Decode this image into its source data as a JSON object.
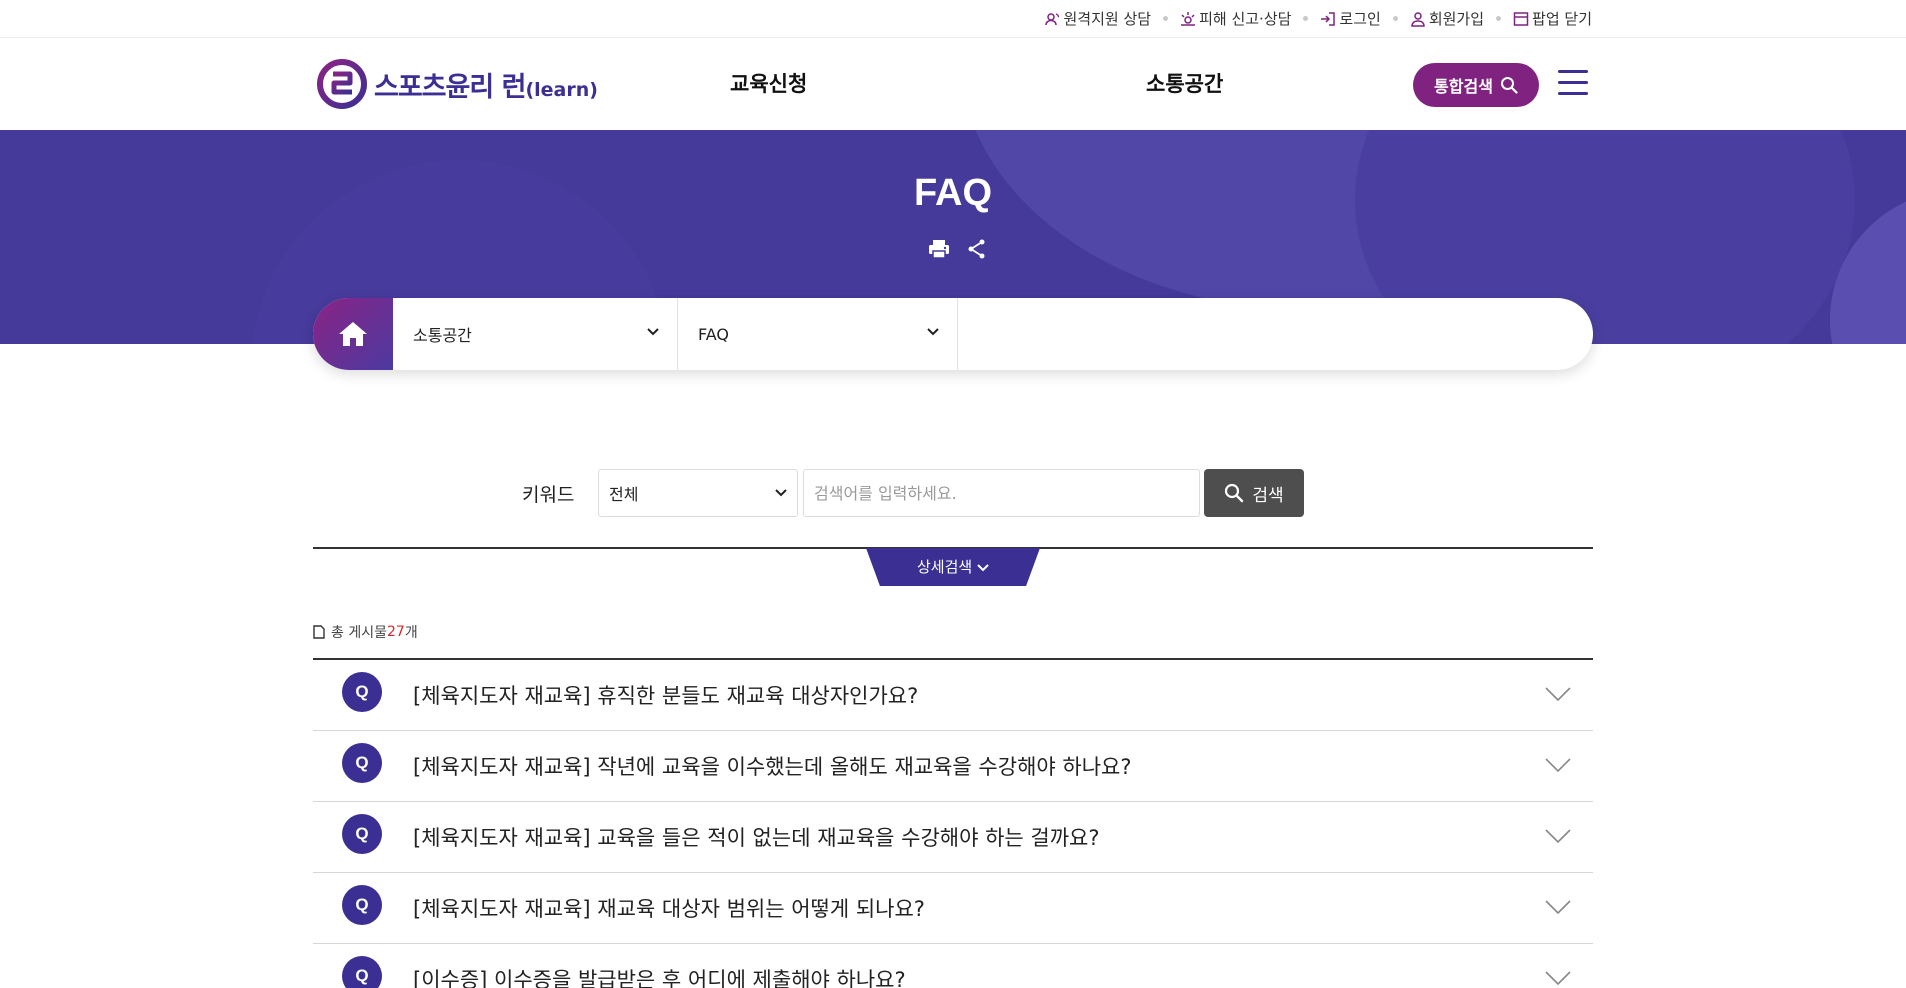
{
  "utility": {
    "items": [
      {
        "label": "원격지원 상담",
        "icon": "remote-support-icon"
      },
      {
        "label": "피해 신고·상담",
        "icon": "report-icon"
      },
      {
        "label": "로그인",
        "icon": "login-icon"
      },
      {
        "label": "회원가입",
        "icon": "user-icon"
      },
      {
        "label": "팝업 닫기",
        "icon": "popup-icon"
      }
    ]
  },
  "header": {
    "logo_main": "스포츠윤리 런",
    "logo_sub": "(learn)",
    "nav": [
      "교육신청",
      "소통공간"
    ],
    "search_all_label": "통합검색"
  },
  "banner": {
    "title": "FAQ"
  },
  "location": {
    "depth1": "소통공간",
    "depth2": "FAQ"
  },
  "search": {
    "label": "키워드",
    "select_value": "전체",
    "placeholder": "검색어를 입력하세요.",
    "button_label": "검색",
    "detail_label": "상세검색"
  },
  "list": {
    "total_prefix": "총 게시물 ",
    "total_count": "27",
    "total_suffix": "개",
    "badge": "Q",
    "items": [
      "[체육지도자 재교육] 휴직한 분들도 재교육 대상자인가요?",
      "[체육지도자 재교육] 작년에 교육을 이수했는데 올해도 재교육을 수강해야 하나요?",
      "[체육지도자 재교육] 교육을 들은 적이 없는데 재교육을 수강해야 하는 걸까요?",
      "[체육지도자 재교육] 재교육 대상자 범위는 어떻게 되나요?",
      "[이수증] 이수증을 발급받은 후 어디에 제출해야 하나요?"
    ]
  },
  "colors": {
    "primary": "#3b2f93",
    "accent": "#7f2280",
    "banner": "#45399a",
    "count": "#d62828"
  }
}
